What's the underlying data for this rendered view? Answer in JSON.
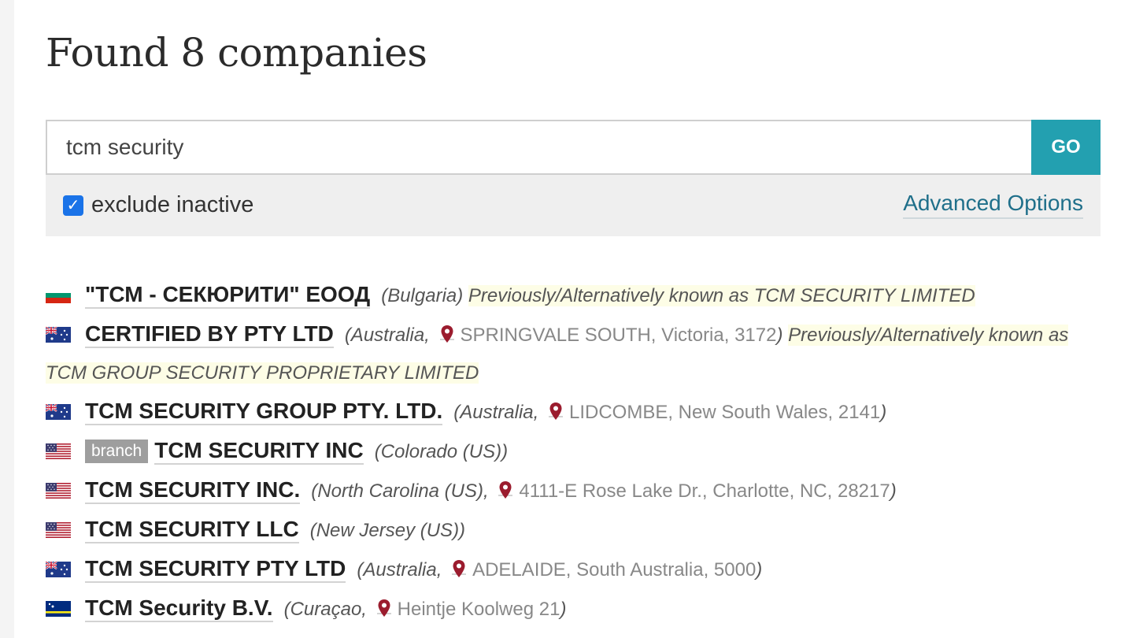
{
  "header": {
    "title": "Found 8 companies"
  },
  "search": {
    "value": "tcm security",
    "go_label": "GO"
  },
  "options": {
    "exclude_inactive_label": "exclude inactive",
    "advanced_label": "Advanced Options"
  },
  "results": [
    {
      "flag": "bg",
      "name": "\"ТСМ - СЕКЮРИТИ\" ЕООД",
      "jurisdiction": "(Bulgaria)",
      "address": "",
      "aka": "Previously/Alternatively known as TCM SECURITY LIMITED",
      "branch": ""
    },
    {
      "flag": "au",
      "name": "CERTIFIED BY PTY LTD",
      "jurisdiction": "(Australia,",
      "address": "SPRINGVALE SOUTH, Victoria, 3172",
      "close": ")",
      "aka": "Previously/Alternatively known as TCM GROUP SECURITY PROPRIETARY LIMITED",
      "branch": ""
    },
    {
      "flag": "au",
      "name": "TCM SECURITY GROUP PTY. LTD.",
      "jurisdiction": "(Australia,",
      "address": "LIDCOMBE, New South Wales, 2141",
      "close": ")",
      "aka": "",
      "branch": ""
    },
    {
      "flag": "us",
      "name": "TCM SECURITY INC",
      "jurisdiction": "(Colorado (US))",
      "address": "",
      "aka": "",
      "branch": "branch"
    },
    {
      "flag": "us",
      "name": "TCM SECURITY INC.",
      "jurisdiction": "(North Carolina (US),",
      "address": "4111-E Rose Lake Dr., Charlotte, NC, 28217",
      "close": ")",
      "aka": "",
      "branch": ""
    },
    {
      "flag": "us",
      "name": "TCM SECURITY LLC",
      "jurisdiction": "(New Jersey (US))",
      "address": "",
      "aka": "",
      "branch": ""
    },
    {
      "flag": "au",
      "name": "TCM SECURITY PTY LTD",
      "jurisdiction": "(Australia,",
      "address": "ADELAIDE, South Australia, 5000",
      "close": ")",
      "aka": "",
      "branch": ""
    },
    {
      "flag": "cw",
      "name": "TCM Security B.V.",
      "jurisdiction": "(Curaçao,",
      "address": "Heintje Koolweg 21",
      "close": ")",
      "aka": "",
      "branch": ""
    }
  ],
  "colors": {
    "accent": "#23a0b0",
    "link": "#1f6f8a",
    "pin": "#9b1c2e",
    "highlight": "#fdfde6"
  }
}
